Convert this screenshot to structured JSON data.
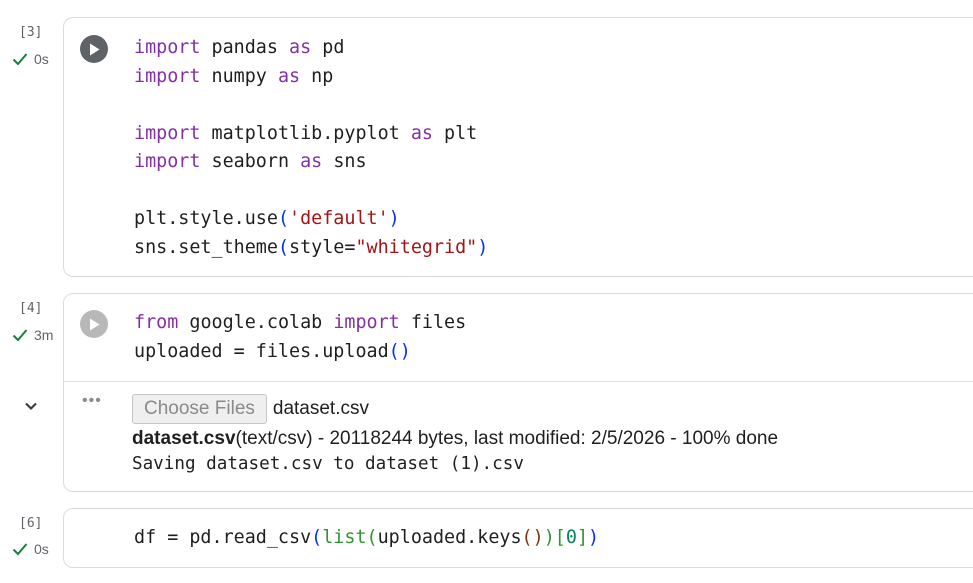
{
  "cells": [
    {
      "exec_count": "[3]",
      "exec_time": "0s",
      "code": [
        [
          [
            "import",
            "kw"
          ],
          [
            " pandas ",
            ""
          ],
          [
            "as",
            "kw"
          ],
          [
            " pd",
            ""
          ]
        ],
        [
          [
            "import",
            "kw"
          ],
          [
            " numpy ",
            ""
          ],
          [
            "as",
            "kw"
          ],
          [
            " np",
            ""
          ]
        ],
        [],
        [
          [
            "import",
            "kw"
          ],
          [
            " matplotlib.pyplot ",
            ""
          ],
          [
            "as",
            "kw"
          ],
          [
            " plt",
            ""
          ]
        ],
        [
          [
            "import",
            "kw"
          ],
          [
            " seaborn ",
            ""
          ],
          [
            "as",
            "kw"
          ],
          [
            " sns",
            ""
          ]
        ],
        [],
        [
          [
            "plt.style.use",
            ""
          ],
          [
            "(",
            "p1"
          ],
          [
            "'default'",
            "str"
          ],
          [
            ")",
            "p1"
          ]
        ],
        [
          [
            "sns.set_theme",
            ""
          ],
          [
            "(",
            "p1"
          ],
          [
            "style=",
            ""
          ],
          [
            "\"whitegrid\"",
            "str"
          ],
          [
            ")",
            "p1"
          ]
        ]
      ]
    },
    {
      "exec_count": "[4]",
      "exec_time": "3m",
      "code": [
        [
          [
            "from",
            "kw"
          ],
          [
            " google.colab ",
            ""
          ],
          [
            "import",
            "kw"
          ],
          [
            " files",
            ""
          ]
        ],
        [
          [
            "uploaded = files.upload",
            ""
          ],
          [
            "()",
            "p1"
          ]
        ]
      ],
      "output": {
        "menu_icon": "more-horiz-icon",
        "choose_button": "Choose Files",
        "chosen_file": "dataset.csv",
        "upload_file_bold": "dataset.csv",
        "upload_details": "(text/csv) - 20118244 bytes, last modified: 2/5/2026 - 100% done",
        "saving_text": "Saving dataset.csv to dataset (1).csv"
      }
    },
    {
      "exec_count": "[6]",
      "exec_time": "0s",
      "code": [
        [
          [
            "df = pd.read_csv",
            ""
          ],
          [
            "(",
            "p1"
          ],
          [
            "list",
            "p2"
          ],
          [
            "(",
            "p2"
          ],
          [
            "uploaded.keys",
            ""
          ],
          [
            "()",
            "p3"
          ],
          [
            ")",
            "p2"
          ],
          [
            "[",
            "p2"
          ],
          [
            "0",
            "num"
          ],
          [
            "]",
            "p2"
          ],
          [
            ")",
            "p1"
          ]
        ]
      ]
    }
  ],
  "colors": {
    "keyword": "#8330a8",
    "string": "#a31515",
    "success_check": "#188038",
    "run_button_active": "#5f6368",
    "run_button_idle": "#b8b8b8"
  }
}
